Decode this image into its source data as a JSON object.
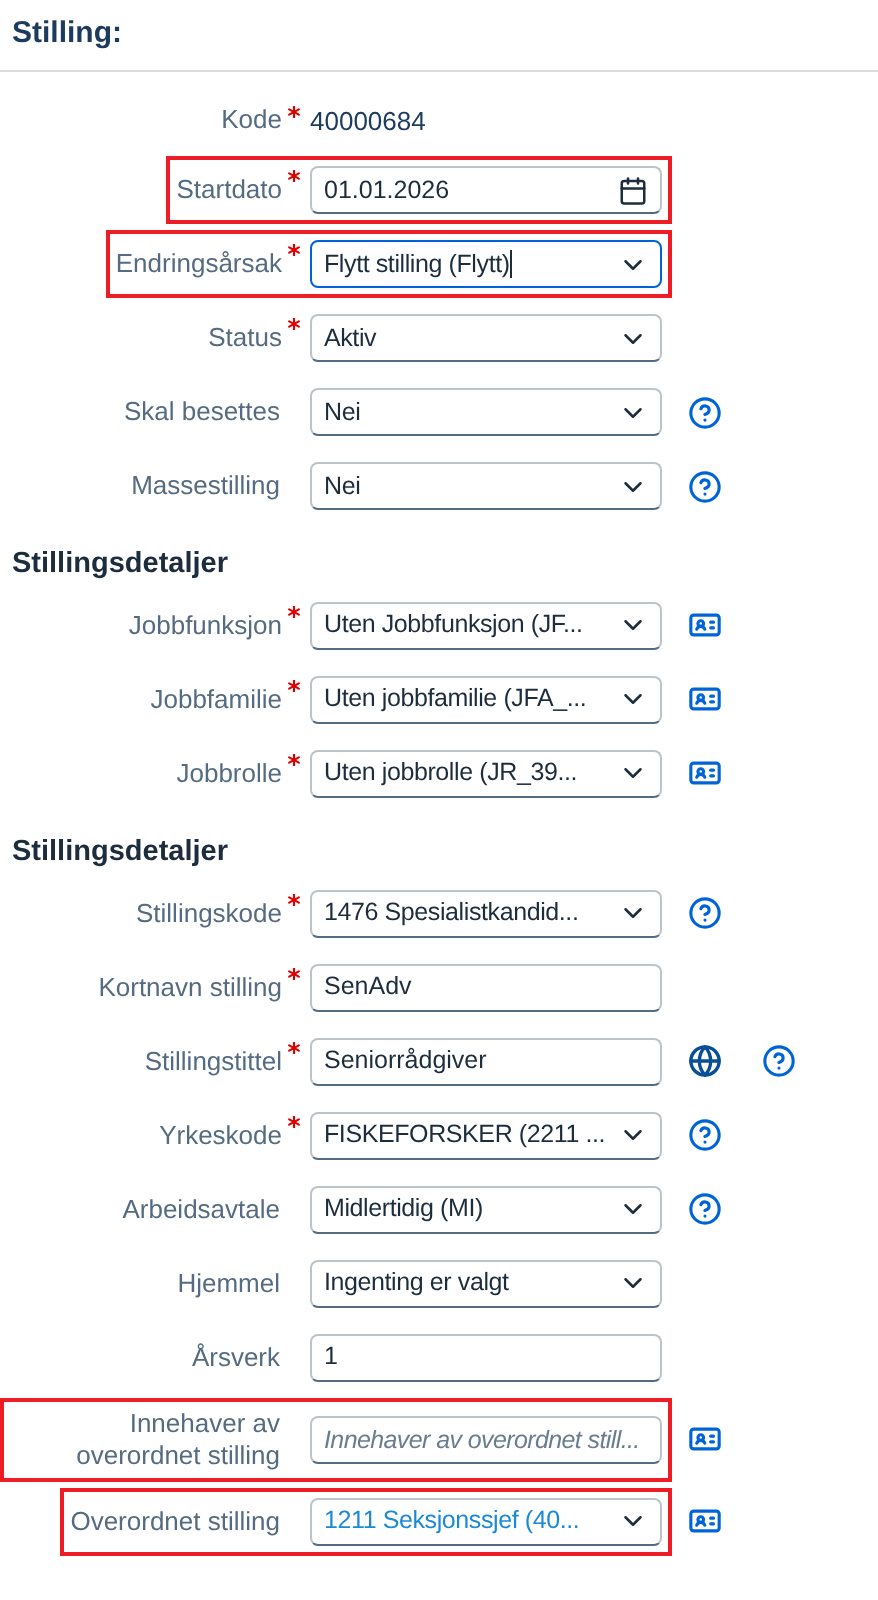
{
  "title": "Stilling:",
  "sections": [
    {
      "fields": [
        {
          "label": "Kode",
          "required": true,
          "kind": "display",
          "value": "40000684",
          "highlighted": false
        },
        {
          "label": "Startdato",
          "required": true,
          "kind": "date",
          "value": "01.01.2026",
          "highlighted": true,
          "focused": false
        },
        {
          "label": "Endringsårsak",
          "required": true,
          "kind": "select",
          "value": "Flytt stilling (Flytt)",
          "highlighted": true,
          "focused": true
        },
        {
          "label": "Status",
          "required": true,
          "kind": "select",
          "value": "Aktiv",
          "highlighted": false,
          "focused": false
        },
        {
          "label": "Skal besettes",
          "required": false,
          "kind": "select",
          "value": "Nei",
          "highlighted": false,
          "focused": false,
          "icons": [
            {
              "kind": "help"
            }
          ]
        },
        {
          "label": "Massestilling",
          "required": false,
          "kind": "select",
          "value": "Nei",
          "highlighted": false,
          "focused": false,
          "icons": [
            {
              "kind": "help"
            }
          ]
        }
      ]
    },
    {
      "heading": "Stillingsdetaljer",
      "fields": [
        {
          "label": "Jobbfunksjon",
          "required": true,
          "kind": "select",
          "value": "Uten Jobbfunksjon (JF...",
          "highlighted": false,
          "focused": false,
          "icons": [
            {
              "kind": "card"
            }
          ]
        },
        {
          "label": "Jobbfamilie",
          "required": true,
          "kind": "select",
          "value": "Uten jobbfamilie (JFA_...",
          "highlighted": false,
          "focused": false,
          "icons": [
            {
              "kind": "card"
            }
          ]
        },
        {
          "label": "Jobbrolle",
          "required": true,
          "kind": "select",
          "value": "Uten jobbrolle (JR_39...",
          "highlighted": false,
          "focused": false,
          "icons": [
            {
              "kind": "card"
            }
          ]
        }
      ]
    },
    {
      "heading": "Stillingsdetaljer",
      "fields": [
        {
          "label": "Stillingskode",
          "required": true,
          "kind": "select",
          "value": "1476  Spesialistkandid...",
          "highlighted": false,
          "focused": false,
          "icons": [
            {
              "kind": "help"
            }
          ]
        },
        {
          "label": "Kortnavn stilling",
          "required": true,
          "kind": "text",
          "value": "SenAdv",
          "highlighted": false,
          "focused": false
        },
        {
          "label": "Stillingstittel",
          "required": true,
          "kind": "text",
          "value": "Seniorrådgiver",
          "highlighted": false,
          "focused": false,
          "icons": [
            {
              "kind": "globe"
            },
            {
              "kind": "help"
            }
          ]
        },
        {
          "label": "Yrkeskode",
          "required": true,
          "kind": "select",
          "value": "FISKEFORSKER (2211 ...",
          "highlighted": false,
          "focused": false,
          "icons": [
            {
              "kind": "help"
            }
          ]
        },
        {
          "label": "Arbeidsavtale",
          "required": false,
          "kind": "select",
          "value": "Midlertidig (MI)",
          "highlighted": false,
          "focused": false,
          "icons": [
            {
              "kind": "help"
            }
          ]
        },
        {
          "label": "Hjemmel",
          "required": false,
          "kind": "select",
          "value": "Ingenting er valgt",
          "highlighted": false,
          "focused": false
        },
        {
          "label": "Årsverk",
          "required": false,
          "kind": "text",
          "value": "1",
          "highlighted": false,
          "focused": false
        },
        {
          "label": "Innehaver av overordnet stilling",
          "required": false,
          "kind": "text",
          "placeholder": "Innehaver av overordnet still...",
          "highlighted": true,
          "focused": false,
          "icons": [
            {
              "kind": "card"
            }
          ]
        },
        {
          "label": "Overordnet stilling",
          "required": false,
          "kind": "select",
          "value": "1211 Seksjonssjef (40...",
          "link": true,
          "highlighted": true,
          "focused": false,
          "icons": [
            {
              "kind": "card"
            }
          ]
        }
      ]
    }
  ]
}
